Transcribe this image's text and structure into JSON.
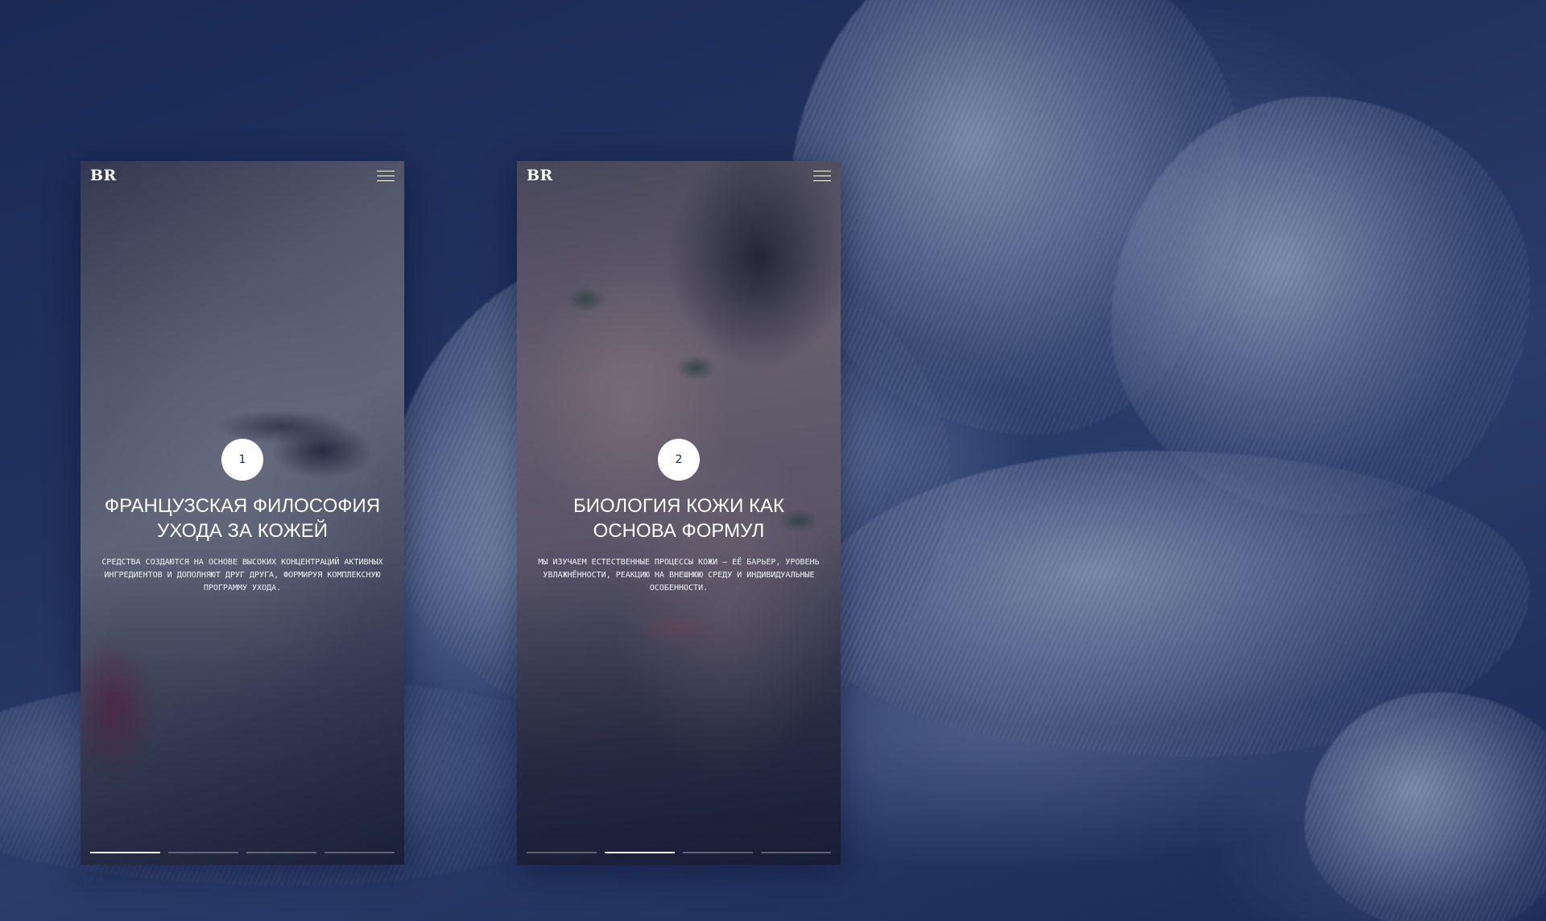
{
  "brand": "BR",
  "slides": [
    {
      "number": "1",
      "title": "Французская философия ухода за кожей",
      "description": "Средства создаются на основе высоких концентраций активных ингредиентов и дополняют друг друга, формируя комплексную программу ухода.",
      "active_segment": 1
    },
    {
      "number": "2",
      "title": "Биология кожи как основа формул",
      "description": "Мы изучаем естественные процессы кожи — её барьер, уровень увлажнённости, реакцию на внешнюю среду и индивидуальные особенности.",
      "active_segment": 2
    }
  ],
  "progress_segments": 4,
  "colors": {
    "background": "#1b2a52",
    "text": "#ffffff",
    "badge": "#ffffff"
  },
  "icons": {
    "menu": "hamburger-icon"
  }
}
